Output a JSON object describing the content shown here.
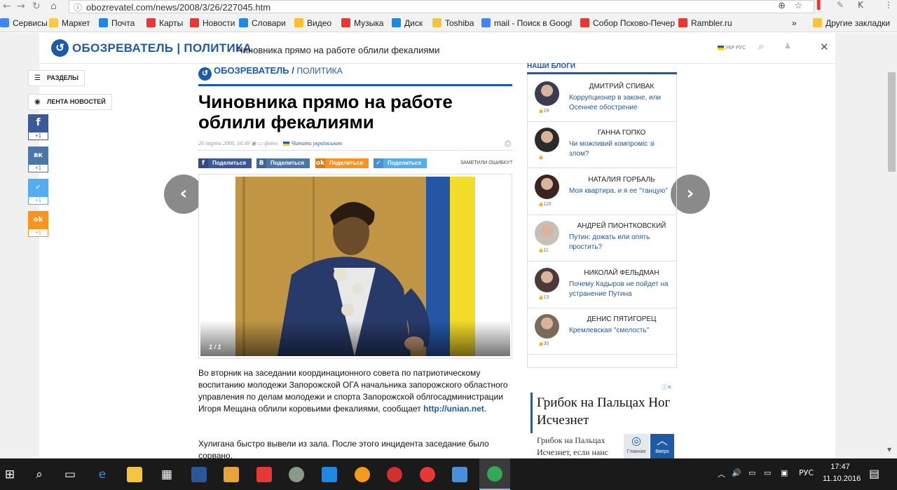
{
  "browser": {
    "url": "obozrevatel.com/news/2008/3/26/227045.htm",
    "bookmarks": [
      {
        "label": "Сервисы",
        "color": "#4285f4"
      },
      {
        "label": "Маркет",
        "color": "#f7c948"
      },
      {
        "label": "Почта",
        "color": "#1e88e5"
      },
      {
        "label": "Карты",
        "color": "#e53935"
      },
      {
        "label": "Новости",
        "color": "#e53935"
      },
      {
        "label": "Словари",
        "color": "#1e88e5"
      },
      {
        "label": "Видео",
        "color": "#fbc02d"
      },
      {
        "label": "Музыка",
        "color": "#e53935"
      },
      {
        "label": "Диск",
        "color": "#1e88e5"
      },
      {
        "label": "Toshiba",
        "color": "#f5c242"
      },
      {
        "label": "mail - Поиск в Googl",
        "color": "#4285f4"
      },
      {
        "label": "Собор Псково-Печер",
        "color": "#e53935"
      },
      {
        "label": "Rambler.ru",
        "color": "#e53935"
      }
    ],
    "bookmarks_more": "»",
    "other_bookmarks": "Другие закладки"
  },
  "header": {
    "logo_text": "ОБОЗРЕВАТЕЛЬ | ПОЛИТИКА",
    "title": "Чиновника прямо на работе облили фекалиями",
    "lang": "УКР РУС"
  },
  "sidebar": {
    "sections_label": "РАЗДЕЛЫ",
    "news_feed_label": "ЛЕНТА НОВОСТЕЙ",
    "shares": [
      {
        "icon": "f",
        "count": "+1",
        "color": "#3b5998"
      },
      {
        "icon": "vk",
        "count": "+1",
        "color": "#4a76a8"
      },
      {
        "icon": "tw",
        "count": "+1",
        "color": "#55acee"
      },
      {
        "icon": "ok",
        "count": "+1",
        "color": "#f7931e"
      }
    ]
  },
  "article": {
    "brand": "ОБОЗРЕВАТЕЛЬ",
    "section": "ПОЛИТИКА",
    "headline": "Чиновника прямо на работе облили фекалиями",
    "meta_date": "26 марта 2008, 16:49",
    "meta_photo": "фото",
    "meta_ukr": "Читати українською",
    "share_buttons": [
      {
        "label": "Поделиться",
        "icon": "f",
        "color": "#3b5998"
      },
      {
        "label": "Поделиться",
        "icon": "В",
        "color": "#4a76a8"
      },
      {
        "label": "Поделиться",
        "icon": "ok",
        "color": "#f7931e"
      },
      {
        "label": "Поделиться",
        "icon": "tw",
        "color": "#55acee"
      }
    ],
    "report_error": "ЗАМЕТИЛИ ОШИБКУ?",
    "photo_counter": "1 / 1",
    "paragraph1": "Во вторник на заседании координационного совета по патриотическому воспитанию молодежи Запорожской ОГА начальника запорожского областного управления по делам молодежи и спорта Запорожской облгосадминистрации Игоря Мещана облили коровьими фекалиями, сообщает ",
    "paragraph1_link": "http://unian.net",
    "paragraph1_end": ".",
    "paragraph2": "Хулигана быстро вывели из зала. После этого инцидента заседание было сорвано."
  },
  "blogs": {
    "header": "НАШИ БЛОГИ",
    "items": [
      {
        "author": "ДМИТРИЙ СПИВАК",
        "title": "Коррупционер в законе, или Осеннее обострение",
        "likes": "19"
      },
      {
        "author": "ГАННА ГОПКО",
        "title": "Чи можливий компроміс зі злом?",
        "likes": ""
      },
      {
        "author": "НАТАЛИЯ ГОРБАЛЬ",
        "title": "Моя квартира, и я ее \"танцую\"",
        "likes": "115"
      },
      {
        "author": "АНДРЕЙ ПИОНТКОВСКИЙ",
        "title": "Путин: дожать или опять простить?",
        "likes": "11"
      },
      {
        "author": "НИКОЛАЙ ФЕЛЬДМАН",
        "title": "Почему Кадыров не пойдет на устранение Путина",
        "likes": "13"
      },
      {
        "author": "ДЕНИС ПЯТИГОРЕЦ",
        "title": "Кремлевская \"смелость\"",
        "likes": "30"
      }
    ]
  },
  "ad": {
    "title": "Грибок на Пальцах Ног Исчезнет",
    "text": "Грибок на Пальцах Исчезнет, если нанс",
    "home_label": "Главная",
    "up_label": "Вверх"
  },
  "taskbar": {
    "lang": "РУС",
    "time": "17:47",
    "date": "11.10.2016"
  }
}
